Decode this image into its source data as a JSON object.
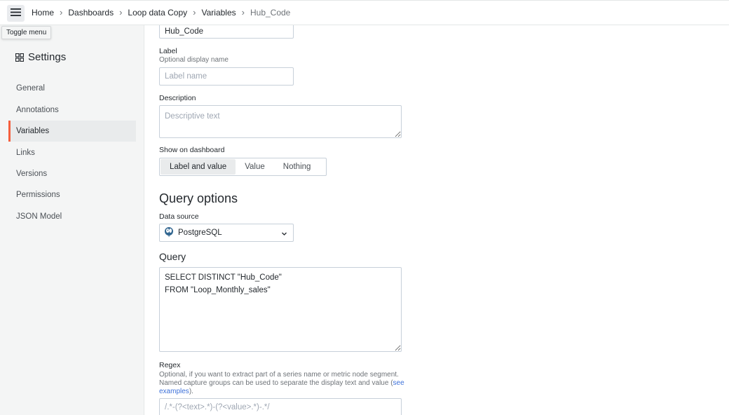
{
  "topbar": {
    "breadcrumbs": [
      "Home",
      "Dashboards",
      "Loop data Copy",
      "Variables",
      "Hub_Code"
    ],
    "tooltip": "Toggle menu"
  },
  "sidebar": {
    "title": "Settings",
    "items": [
      {
        "label": "General"
      },
      {
        "label": "Annotations"
      },
      {
        "label": "Variables",
        "active": true
      },
      {
        "label": "Links"
      },
      {
        "label": "Versions"
      },
      {
        "label": "Permissions"
      },
      {
        "label": "JSON Model"
      }
    ]
  },
  "form": {
    "name_value": "Hub_Code",
    "label": {
      "title": "Label",
      "description": "Optional display name",
      "placeholder": "Label name"
    },
    "description": {
      "title": "Description",
      "placeholder": "Descriptive text"
    },
    "show_on_dashboard": {
      "title": "Show on dashboard",
      "options": [
        "Label and value",
        "Value",
        "Nothing"
      ],
      "selected": "Label and value"
    },
    "query_options": {
      "title": "Query options",
      "data_source_label": "Data source",
      "data_source_value": "PostgreSQL",
      "query_title": "Query",
      "query_value": "SELECT DISTINCT \"Hub_Code\"\nFROM \"Loop_Monthly_sales\""
    },
    "regex": {
      "title": "Regex",
      "description_line1": "Optional, if you want to extract part of a series name or metric node segment.",
      "description_line2": "Named capture groups can be used to separate the display text and value (",
      "link_see": "see",
      "link_examples": "examples",
      "description_end": ").",
      "placeholder": "/.*-(?<text>.*)-(?<value>.*)-.*/"
    }
  },
  "colors": {
    "accent": "#f55f3e",
    "link": "#3d71d9",
    "postgres_blue": "#336791"
  }
}
